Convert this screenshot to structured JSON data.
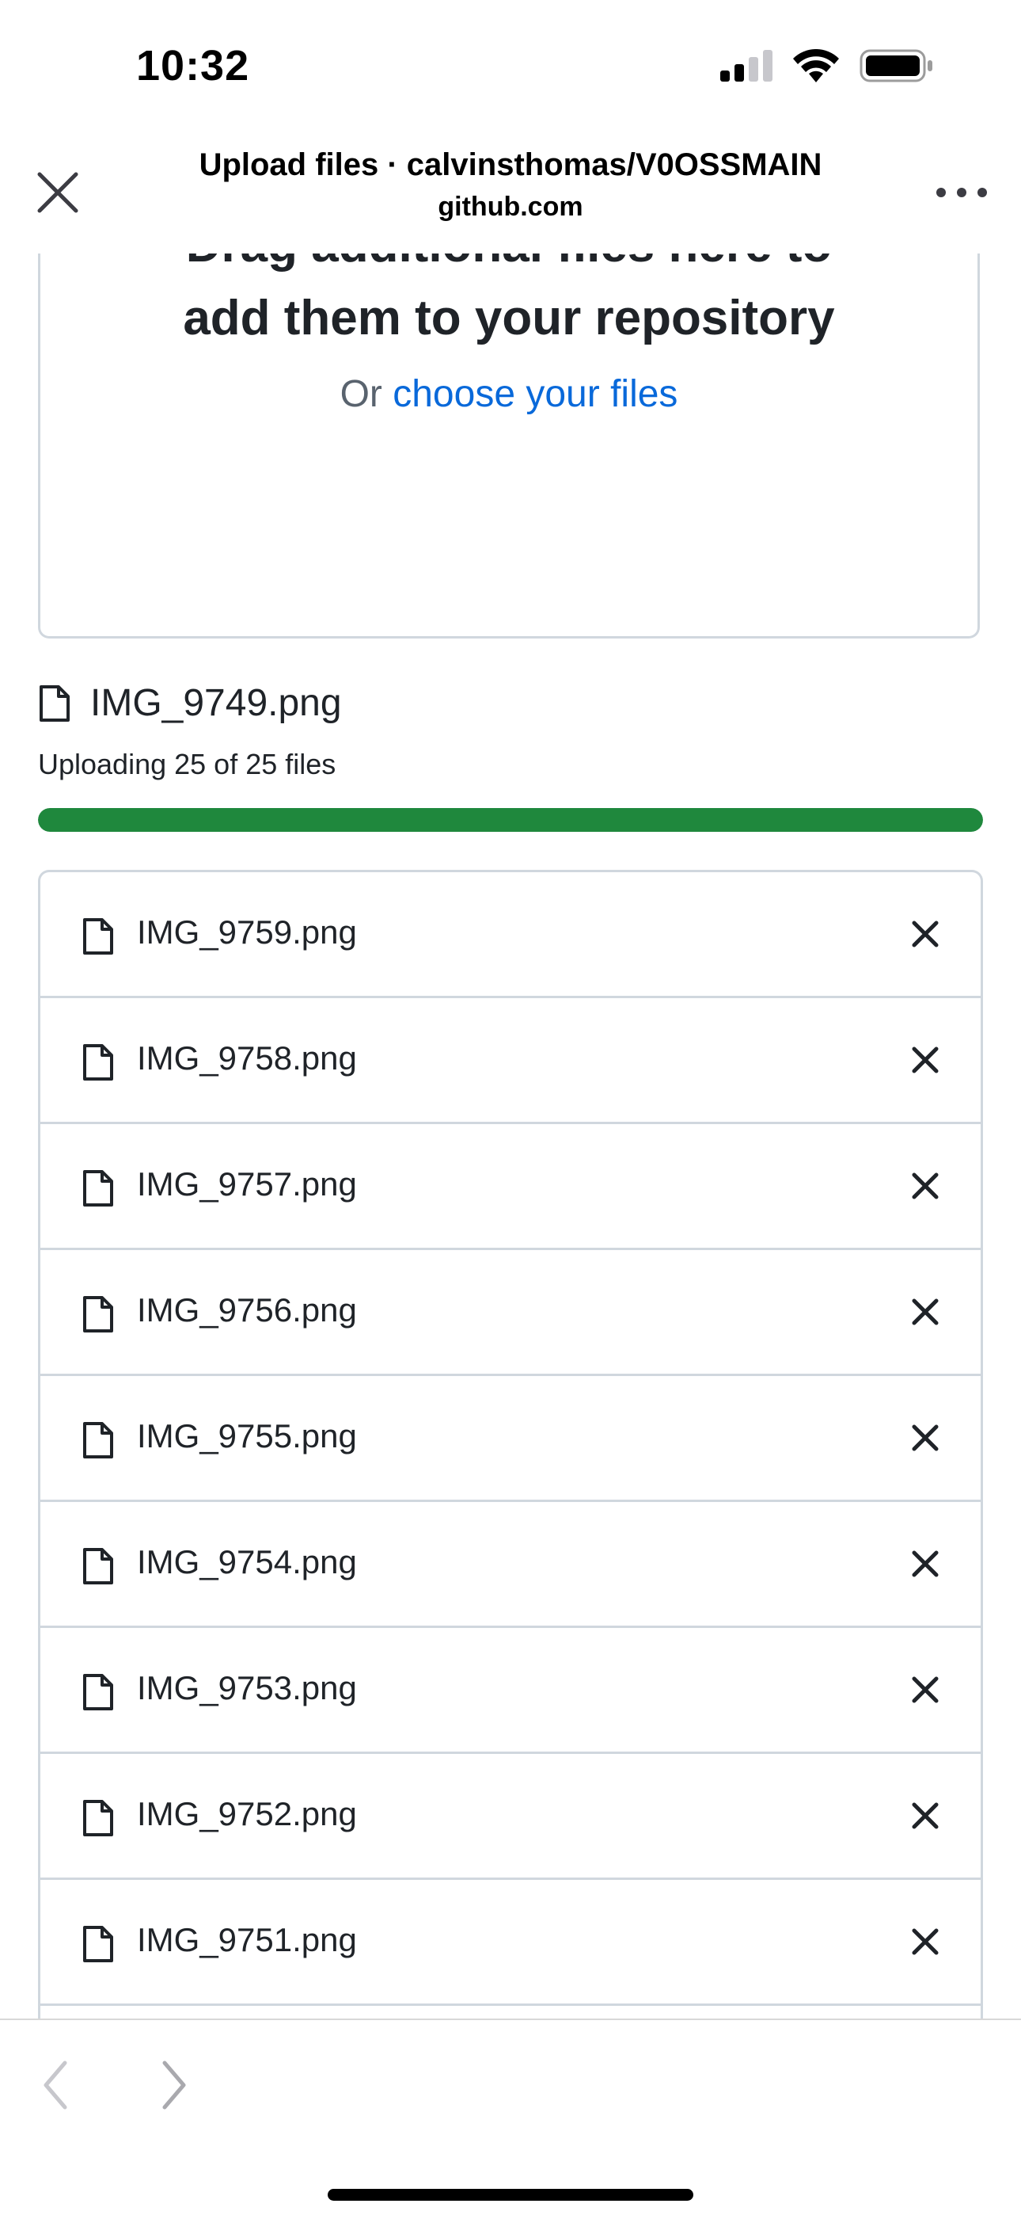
{
  "status_bar": {
    "time": "10:32",
    "icons": [
      "signal-icon",
      "wifi-icon",
      "battery-icon"
    ]
  },
  "browser": {
    "title": "Upload files · calvinsthomas/V0OSSMAIN",
    "domain": "github.com",
    "close_icon": "close-icon",
    "more_icon": "more-icon"
  },
  "dropzone": {
    "line1": "Drag additional files here to",
    "line2": "add them to your repository",
    "or_text": "Or",
    "choose_link": "choose your files"
  },
  "upload": {
    "current_file": "IMG_9749.png",
    "status": "Uploading 25 of 25 files",
    "progress_fraction": 1.0,
    "progress_color": "#1f883d"
  },
  "files": [
    {
      "name": "IMG_9759.png"
    },
    {
      "name": "IMG_9758.png"
    },
    {
      "name": "IMG_9757.png"
    },
    {
      "name": "IMG_9756.png"
    },
    {
      "name": "IMG_9755.png"
    },
    {
      "name": "IMG_9754.png"
    },
    {
      "name": "IMG_9753.png"
    },
    {
      "name": "IMG_9752.png"
    },
    {
      "name": "IMG_9751.png"
    },
    {
      "name": ""
    }
  ],
  "toolbar": {
    "back_icon": "chevron-left-icon",
    "forward_icon": "chevron-right-icon"
  },
  "colors": {
    "link": "#0969da",
    "border": "#d0d7de",
    "text": "#1f2328"
  }
}
